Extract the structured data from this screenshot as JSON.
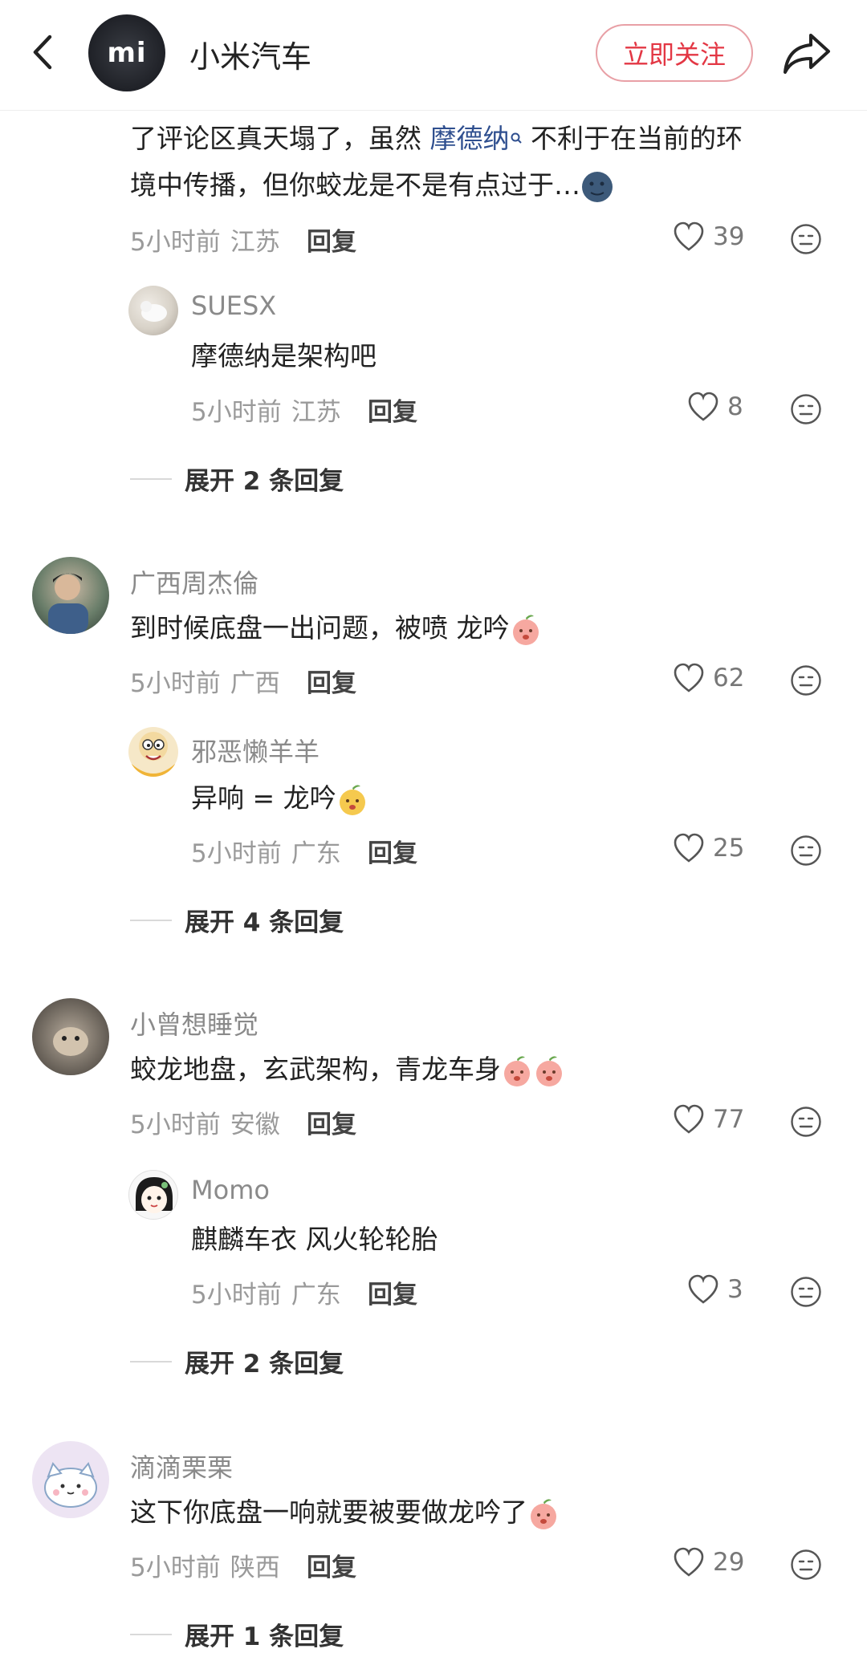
{
  "header": {
    "brand_name": "小米汽车",
    "avatar_logo": "mi",
    "follow_label": "立即关注",
    "icons": {
      "back": "back-arrow-icon",
      "share": "share-icon"
    }
  },
  "comments": [
    {
      "text_before": "了评论区真天塌了，虽然 ",
      "link": "摩德纳",
      "text_after_1": " 不利于在当前的环",
      "text_line2": "境中传播，但你蛟龙是不是有点过于…",
      "time": "5小时前",
      "location": "江苏",
      "reply": "回复",
      "likes": "39",
      "sub": {
        "name": "SUESX",
        "text": "摩德纳是架构吧",
        "time": "5小时前",
        "location": "江苏",
        "reply": "回复",
        "likes": "8"
      },
      "expand": "展开 2 条回复"
    },
    {
      "name": "广西周杰倫",
      "text": "到时候底盘一出问题，被喷 龙吟",
      "time": "5小时前",
      "location": "广西",
      "reply": "回复",
      "likes": "62",
      "sub": {
        "name": "邪恶懒羊羊",
        "text": "异响 = 龙吟",
        "time": "5小时前",
        "location": "广东",
        "reply": "回复",
        "likes": "25"
      },
      "expand": "展开 4 条回复"
    },
    {
      "name": "小曾想睡觉",
      "text": "蛟龙地盘，玄武架构，青龙车身",
      "time": "5小时前",
      "location": "安徽",
      "reply": "回复",
      "likes": "77",
      "sub": {
        "name": "Momo",
        "text": "麒麟车衣 风火轮轮胎",
        "time": "5小时前",
        "location": "广东",
        "reply": "回复",
        "likes": "3"
      },
      "expand": "展开 2 条回复"
    },
    {
      "name": "滴滴栗栗",
      "text": "这下你底盘一响就要被要做龙吟了",
      "time": "5小时前",
      "location": "陕西",
      "reply": "回复",
      "likes": "29",
      "expand": "展开 1 条回复"
    }
  ],
  "colors": {
    "accent": "#e33744",
    "link": "#2f4f8f",
    "meta_gray": "#9a9a9a"
  }
}
